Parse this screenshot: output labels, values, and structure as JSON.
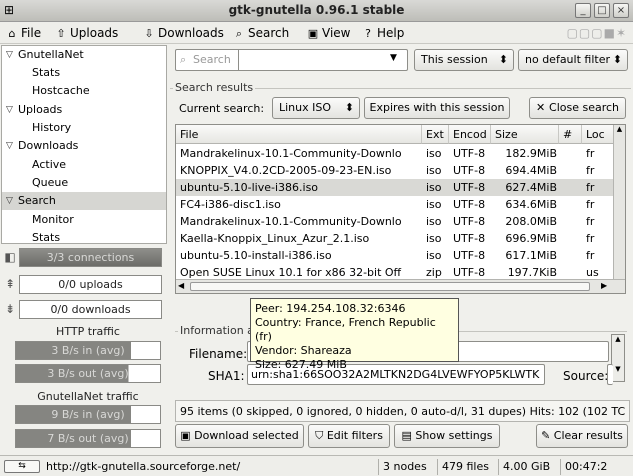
{
  "window": {
    "title": "gtk-gnutella 0.96.1 stable"
  },
  "menu": [
    {
      "label": "File",
      "icon": "home-icon"
    },
    {
      "label": "Uploads",
      "icon": "up-arrow-icon"
    },
    {
      "label": "Downloads",
      "icon": "down-arrow-icon"
    },
    {
      "label": "Search",
      "icon": "search-icon"
    },
    {
      "label": "View",
      "icon": "view-icon"
    },
    {
      "label": "Help",
      "icon": "help-icon"
    }
  ],
  "sidebar": {
    "items": [
      {
        "label": "GnutellaNet",
        "level": 0,
        "arrow": "▽"
      },
      {
        "label": "Stats",
        "level": 1
      },
      {
        "label": "Hostcache",
        "level": 1
      },
      {
        "label": "Uploads",
        "level": 0,
        "arrow": "▽"
      },
      {
        "label": "History",
        "level": 1
      },
      {
        "label": "Downloads",
        "level": 0,
        "arrow": "▽"
      },
      {
        "label": "Active",
        "level": 1
      },
      {
        "label": "Queue",
        "level": 1
      },
      {
        "label": "Search",
        "level": 0,
        "arrow": "▽",
        "selected": true
      },
      {
        "label": "Monitor",
        "level": 1
      },
      {
        "label": "Stats",
        "level": 1
      }
    ]
  },
  "panel": {
    "connections": "3/3 connections",
    "uploads": "0/0 uploads",
    "downloads": "0/0 downloads",
    "http_label": "HTTP traffic",
    "http_in": "3 B/s in (avg)",
    "http_out": "3 B/s out (avg)",
    "gnet_label": "GnutellaNet traffic",
    "gnet_in": "9 B/s in (avg)",
    "gnet_out": "7 B/s out (avg)"
  },
  "search_bar": {
    "placeholder": "Search",
    "session": "This session",
    "filter": "no default filter"
  },
  "results": {
    "legend": "Search results",
    "current_label": "Current search:",
    "current_value": "Linux ISO",
    "expires": "Expires with this session",
    "close": "Close search",
    "columns": [
      "File",
      "Ext",
      "Encod",
      "Size",
      "#",
      "Loc"
    ],
    "rows": [
      {
        "file": "Mandrakelinux-10.1-Community-Downlo",
        "ext": "iso",
        "enc": "UTF-8",
        "size": "182.9MiB",
        "num": "",
        "loc": "fr"
      },
      {
        "file": "KNOPPIX_V4.0.2CD-2005-09-23-EN.iso",
        "ext": "iso",
        "enc": "UTF-8",
        "size": "694.4MiB",
        "num": "",
        "loc": "fr"
      },
      {
        "file": "ubuntu-5.10-live-i386.iso",
        "ext": "iso",
        "enc": "UTF-8",
        "size": "627.4MiB",
        "num": "",
        "loc": "fr",
        "selected": true
      },
      {
        "file": "FC4-i386-disc1.iso",
        "ext": "iso",
        "enc": "UTF-8",
        "size": "634.6MiB",
        "num": "",
        "loc": "fr"
      },
      {
        "file": "Mandrakelinux-10.1-Community-Downlo",
        "ext": "iso",
        "enc": "UTF-8",
        "size": "208.0MiB",
        "num": "",
        "loc": "fr"
      },
      {
        "file": "Kaella-Knoppix_Linux_Azur_2.1.iso",
        "ext": "iso",
        "enc": "UTF-8",
        "size": "696.9MiB",
        "num": "",
        "loc": "fr"
      },
      {
        "file": "ubuntu-5.10-install-i386.iso",
        "ext": "iso",
        "enc": "UTF-8",
        "size": "617.1MiB",
        "num": "",
        "loc": "fr"
      },
      {
        "file": "Open SUSE Linux 10.1 for x86 32-bit Off",
        "ext": "zip",
        "enc": "UTF-8",
        "size": "197.7KiB",
        "num": "",
        "loc": "us"
      }
    ]
  },
  "tooltip": {
    "peer": "Peer: 194.254.108.32:6346",
    "country": "Country: France, French Republic (fr)",
    "vendor": "Vendor: Shareaza",
    "size": "Size: 627.49 MiB"
  },
  "info": {
    "legend": "Information a",
    "filename_label": "Filename:",
    "filename_value": "u",
    "sha1_label": "SHA1:",
    "sha1_value": "urn:sha1:66SOO32A2MLTKN2DG4LVEWFYOP5KLWTK",
    "source_label": "Source:"
  },
  "summary": "95 items (0 skipped, 0 ignored, 0 hidden, 0 auto-d/l, 31 dupes) Hits: 102 (102 TC",
  "buttons": {
    "download": "Download selected",
    "edit": "Edit filters",
    "show": "Show settings",
    "clear": "Clear results"
  },
  "status": {
    "url": "http://gtk-gnutella.sourceforge.net/",
    "nodes": "3 nodes",
    "files": "479 files",
    "size": "4.00 GiB",
    "time": "00:47:2"
  }
}
